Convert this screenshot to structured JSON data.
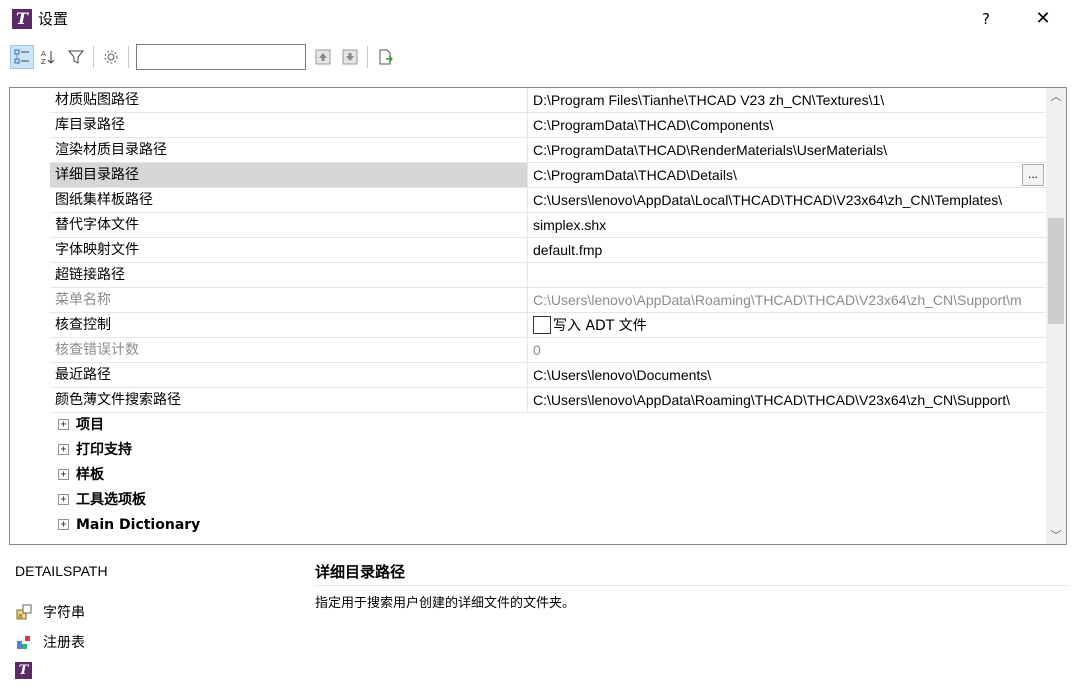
{
  "window": {
    "title": "设置",
    "logo_letter": "T",
    "help_label": "?",
    "close_label": "✕",
    "brand_color": "#5c2a66"
  },
  "toolbar": {
    "search_value": "",
    "search_placeholder": "",
    "buttons": [
      "categorized-view-icon",
      "alphabetical-view-icon",
      "filter-icon",
      "settings-gear-icon",
      "move-up-icon",
      "move-down-icon",
      "export-icon"
    ]
  },
  "properties": [
    {
      "name": "材质贴图路径",
      "value": "D:\\Program Files\\Tianhe\\THCAD V23 zh_CN\\Textures\\1\\"
    },
    {
      "name": "库目录路径",
      "value": "C:\\ProgramData\\THCAD\\Components\\"
    },
    {
      "name": "渲染材质目录路径",
      "value": "C:\\ProgramData\\THCAD\\RenderMaterials\\UserMaterials\\"
    },
    {
      "name": "详细目录路径",
      "value": "C:\\ProgramData\\THCAD\\Details\\",
      "selected": true,
      "browse_label": "..."
    },
    {
      "name": "图纸集样板路径",
      "value": "C:\\Users\\lenovo\\AppData\\Local\\THCAD\\THCAD\\V23x64\\zh_CN\\Templates\\"
    },
    {
      "name": "替代字体文件",
      "value": "simplex.shx"
    },
    {
      "name": "字体映射文件",
      "value": "default.fmp"
    },
    {
      "name": "超链接路径",
      "value": ""
    },
    {
      "name": "菜单名称",
      "value": "C:\\Users\\lenovo\\AppData\\Roaming\\THCAD\\THCAD\\V23x64\\zh_CN\\Support\\m",
      "disabled": true
    },
    {
      "name": "核查控制",
      "value": "写入 ADT 文件",
      "checkbox": true,
      "checked": false
    },
    {
      "name": "核查错误计数",
      "value": "0",
      "disabled": true
    },
    {
      "name": "最近路径",
      "value": "C:\\Users\\lenovo\\Documents\\"
    },
    {
      "name": "颜色薄文件搜索路径",
      "value": "C:\\Users\\lenovo\\AppData\\Roaming\\THCAD\\THCAD\\V23x64\\zh_CN\\Support\\"
    }
  ],
  "categories": [
    {
      "label": "项目",
      "expander": "+"
    },
    {
      "label": "打印支持",
      "expander": "+"
    },
    {
      "label": "样板",
      "expander": "+"
    },
    {
      "label": "工具选项板",
      "expander": "+"
    },
    {
      "label": "Main Dictionary",
      "expander": "+"
    }
  ],
  "info": {
    "variable": "DETAILSPATH",
    "type_label": "字符串",
    "storage_label": "注册表",
    "title": "详细目录路径",
    "description": "指定用于搜索用户创建的详细文件的文件夹。"
  }
}
